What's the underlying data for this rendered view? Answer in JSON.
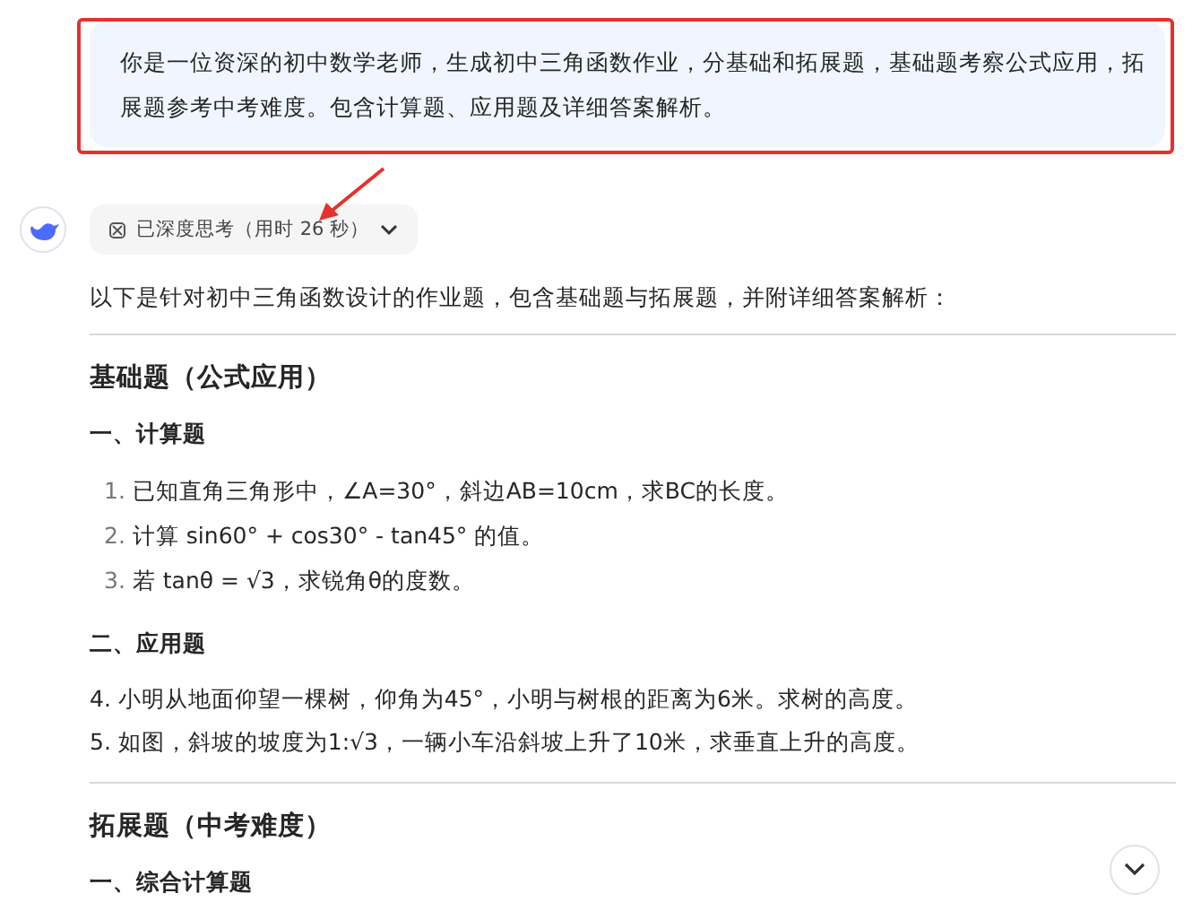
{
  "prompt": {
    "text": "你是一位资深的初中数学老师，生成初中三角函数作业，分基础和拓展题，基础题考察公式应用，拓展题参考中考难度。包含计算题、应用题及详细答案解析。"
  },
  "thinking": {
    "label": "已深度思考（用时 26 秒）",
    "expanded": false
  },
  "answer": {
    "intro": "以下是针对初中三角函数设计的作业题，包含基础题与拓展题，并附详细答案解析：",
    "sections": [
      {
        "heading": "基础题（公式应用）",
        "groups": [
          {
            "title": "一、计算题",
            "kind": "numbered",
            "items": [
              {
                "number": "1.",
                "text": "已知直角三角形中，∠A=30°，斜边AB=10cm，求BC的长度。"
              },
              {
                "number": "2.",
                "text": "计算 sin60° + cos30° - tan45° 的值。"
              },
              {
                "number": "3.",
                "text": "若 tanθ = √3，求锐角θ的度数。"
              }
            ]
          },
          {
            "title": "二、应用题",
            "kind": "plain",
            "items": [
              {
                "text": "4. 小明从地面仰望一棵树，仰角为45°，小明与树根的距离为6米。求树的高度。"
              },
              {
                "text": "5. 如图，斜坡的坡度为1:√3，一辆小车沿斜坡上升了10米，求垂直上升的高度。"
              }
            ]
          }
        ]
      },
      {
        "heading": "拓展题（中考难度）",
        "groups": [
          {
            "title": "一、综合计算题"
          }
        ]
      }
    ]
  }
}
